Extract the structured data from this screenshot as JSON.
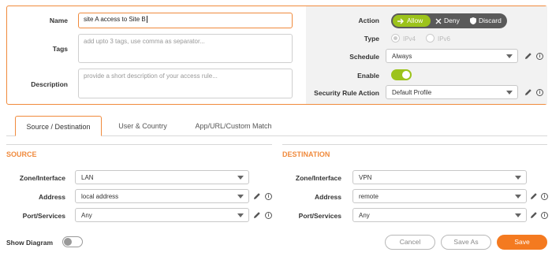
{
  "rule": {
    "name_label": "Name",
    "name_value": "site A access to Site B",
    "tags_label": "Tags",
    "tags_placeholder": "add upto 3 tags, use comma as separator...",
    "description_label": "Description",
    "description_placeholder": "provide a short description of your access rule..."
  },
  "settings": {
    "action_label": "Action",
    "action_options": [
      "Allow",
      "Deny",
      "Discard"
    ],
    "action_selected": "Allow",
    "type_label": "Type",
    "type_options": [
      "IPv4",
      "IPv6"
    ],
    "schedule_label": "Schedule",
    "schedule_value": "Always",
    "enable_label": "Enable",
    "enable_on": true,
    "security_label": "Security Rule Action",
    "security_value": "Default Profile"
  },
  "tabs": [
    {
      "label": "Source / Destination",
      "active": true
    },
    {
      "label": "User & Country",
      "active": false
    },
    {
      "label": "App/URL/Custom Match",
      "active": false
    }
  ],
  "source": {
    "title": "SOURCE",
    "zone_label": "Zone/Interface",
    "zone_value": "LAN",
    "address_label": "Address",
    "address_value": "local address",
    "port_label": "Port/Services",
    "port_value": "Any"
  },
  "destination": {
    "title": "DESTINATION",
    "zone_label": "Zone/Interface",
    "zone_value": "VPN",
    "address_label": "Address",
    "address_value": "remote",
    "port_label": "Port/Services",
    "port_value": "Any"
  },
  "footer": {
    "show_diagram_label": "Show Diagram",
    "show_diagram_on": false,
    "cancel_label": "Cancel",
    "save_as_label": "Save As",
    "save_label": "Save"
  },
  "colors": {
    "accent": "#f47a20",
    "allow_green": "#9cc31b",
    "segment_dark": "#5a5a5a"
  },
  "icons": {
    "edit": "pencil-icon",
    "info": "info-icon",
    "allow": "arrow-right-icon",
    "deny": "x-icon",
    "discard": "shield-icon"
  }
}
